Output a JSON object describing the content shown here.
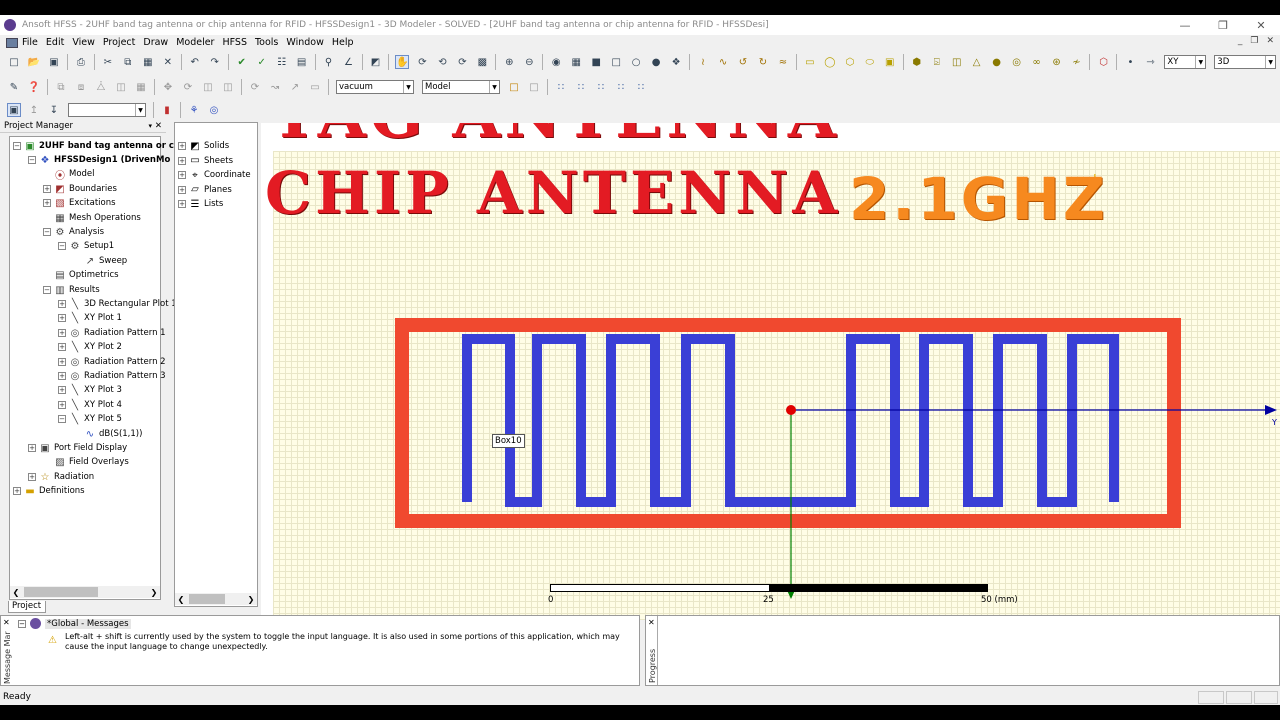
{
  "window": {
    "title": "Ansoft HFSS - 2UHF band tag antenna or chip antenna for RFID - HFSSDesign1 - 3D Modeler - SOLVED - [2UHF band tag antenna or chip antenna for RFID - HFSSDesi]",
    "controls": [
      "—",
      "❐",
      "✕"
    ]
  },
  "menu": [
    "File",
    "Edit",
    "View",
    "Project",
    "Draw",
    "Modeler",
    "HFSS",
    "Tools",
    "Window",
    "Help"
  ],
  "mdi_controls": [
    "_",
    "❐",
    "✕"
  ],
  "toolbar": {
    "material": "vacuum",
    "model_mode": "Model",
    "plane": "XY",
    "view_mode": "3D",
    "toolbar3_select": ""
  },
  "project_manager": {
    "title": "Project Manager",
    "close": "✕",
    "tab": "Project",
    "items": [
      {
        "label": "2UHF band tag antenna or c",
        "bold": true,
        "icon": "project-icon"
      },
      {
        "label": "HFSSDesign1 (DrivenMo",
        "bold": true,
        "icon": "design-icon"
      },
      {
        "label": "Model",
        "icon": "model-icon"
      },
      {
        "label": "Boundaries",
        "icon": "boundaries-icon"
      },
      {
        "label": "Excitations",
        "icon": "excitations-icon"
      },
      {
        "label": "Mesh Operations",
        "icon": "mesh-icon"
      },
      {
        "label": "Analysis",
        "icon": "analysis-icon"
      },
      {
        "label": "Setup1",
        "icon": "setup-icon"
      },
      {
        "label": "Sweep",
        "icon": "sweep-icon"
      },
      {
        "label": "Optimetrics",
        "icon": "optimetrics-icon"
      },
      {
        "label": "Results",
        "icon": "results-icon"
      },
      {
        "label": "3D Rectangular Plot 1",
        "icon": "plot-icon"
      },
      {
        "label": "XY Plot 1",
        "icon": "plot-icon"
      },
      {
        "label": "Radiation Pattern 1",
        "icon": "radiation-pattern-icon"
      },
      {
        "label": "XY Plot 2",
        "icon": "plot-icon"
      },
      {
        "label": "Radiation Pattern 2",
        "icon": "radiation-pattern-icon"
      },
      {
        "label": "Radiation Pattern 3",
        "icon": "radiation-pattern-icon"
      },
      {
        "label": "XY Plot 3",
        "icon": "plot-icon"
      },
      {
        "label": "XY Plot 4",
        "icon": "plot-icon"
      },
      {
        "label": "XY Plot 5",
        "icon": "plot-icon"
      },
      {
        "label": "dB(S(1,1))",
        "icon": "trace-icon"
      },
      {
        "label": "Port Field Display",
        "icon": "port-field-icon"
      },
      {
        "label": "Field Overlays",
        "icon": "field-overlays-icon"
      },
      {
        "label": "Radiation",
        "icon": "radiation-icon"
      },
      {
        "label": "Definitions",
        "icon": "folder-icon"
      }
    ]
  },
  "model_tree": {
    "items": [
      "Solids",
      "Sheets",
      "Coordinate",
      "Planes",
      "Lists"
    ]
  },
  "overlay": {
    "line1": "TAG ANTENNA",
    "line2": "CHIP ANTENNA",
    "freq": "2.1GHZ"
  },
  "model": {
    "object_label": "Box10",
    "axis_label": "Y",
    "colors": {
      "substrate": "#f0492f",
      "trace": "#3a3fd6",
      "axis_y": "#0000a0",
      "axis_x": "#008000",
      "origin": "#e00000"
    }
  },
  "ruler": {
    "ticks": [
      "0",
      "25",
      "50 (mm)"
    ]
  },
  "messages": {
    "tab": "Message Mar",
    "header": "*Global - Messages",
    "text": "Left-alt + shift is currently used by the system to toggle the input language. It is also used in some portions of this application, which may cause the input language to change unexpectedly."
  },
  "progress": {
    "tab": "Progress"
  },
  "status": {
    "text": "Ready"
  }
}
